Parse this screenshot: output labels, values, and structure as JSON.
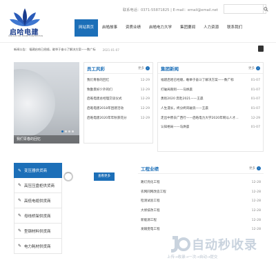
{
  "header": {
    "logo_name": "启哈电建",
    "logo_sub": "QIHA ELECTRIC POWER CONSTRUCTION",
    "contact": "联系电话：0371-55871825    |    E-mail：email@email.net",
    "search_placeholder": ""
  },
  "nav": [
    {
      "label": "网站首页",
      "active": true
    },
    {
      "label": "启皓故事"
    },
    {
      "label": "资质业绩"
    },
    {
      "label": "启皓电力大学"
    },
    {
      "label": "集团要闻"
    },
    {
      "label": "人力资源"
    },
    {
      "label": "联系我们"
    }
  ],
  "notice": {
    "text": "新闻公告：  福建启哈已经顺，敢举于奋斗了解决方案——数广标",
    "date": "2021-01-07"
  },
  "banner": {
    "caption": "我们青春的回忆"
  },
  "staff": {
    "title": "员工风彩",
    "more": "更多",
    "items": [
      {
        "t": "我们青春的回忆",
        "d": "12-29"
      },
      {
        "t": "致勤景好少外的们",
        "d": "12-29"
      },
      {
        "t": "启皓电建总经理交谈仪式",
        "d": "12-29"
      },
      {
        "t": "启皓电建2018年团建活动",
        "d": "12-29"
      },
      {
        "t": "启皓电建2020年年秋获花分",
        "d": "12-29"
      }
    ]
  },
  "news": {
    "title": "集团新闻",
    "more": "更多",
    "items": [
      {
        "t": "福建启哈已经顺，敢举于奋斗了解决方案——数广标",
        "d": "01-07"
      },
      {
        "t": "打破局限则——马焕晨",
        "d": "01-07"
      },
      {
        "t": "勇别2020 奔赴2021——王晨",
        "d": "01-07"
      },
      {
        "t": "人生漫长，终分终风破浪——王晨",
        "d": "01-07"
      },
      {
        "t": "走出中原去广西行——启皓电力大学2020年啊以人才广西考察",
        "d": "12-29"
      },
      {
        "t": "认知格局——马焕晨",
        "d": "01-07"
      }
    ]
  },
  "products": [
    {
      "label": "变压器供货商",
      "active": true
    },
    {
      "label": "高压压盘柜供货商"
    },
    {
      "label": "高低电缆供货商"
    },
    {
      "label": "母线桥架供货商"
    },
    {
      "label": "型钢材料供货商"
    },
    {
      "label": "电力耗材供货商"
    }
  ],
  "view_more": "查看更多",
  "projects": {
    "title": "工程业绩",
    "more": "更多",
    "items": [
      {
        "t": "路灯亮化工程",
        "d": "12-28"
      },
      {
        "t": "农网同网改造工程",
        "d": "12-28"
      },
      {
        "t": "检测试验工程",
        "d": "12-28"
      },
      {
        "t": "大修技改工程",
        "d": "12-28"
      },
      {
        "t": "新能源工程",
        "d": "12-28"
      },
      {
        "t": "发输变电工程",
        "d": "12-28"
      }
    ]
  },
  "watermark": {
    "title": "自动秒收录",
    "sub": "上传→收录→一次→自动→提交"
  },
  "colors": {
    "accent": "#1c6fb8",
    "logo": "#1a3c8c"
  }
}
